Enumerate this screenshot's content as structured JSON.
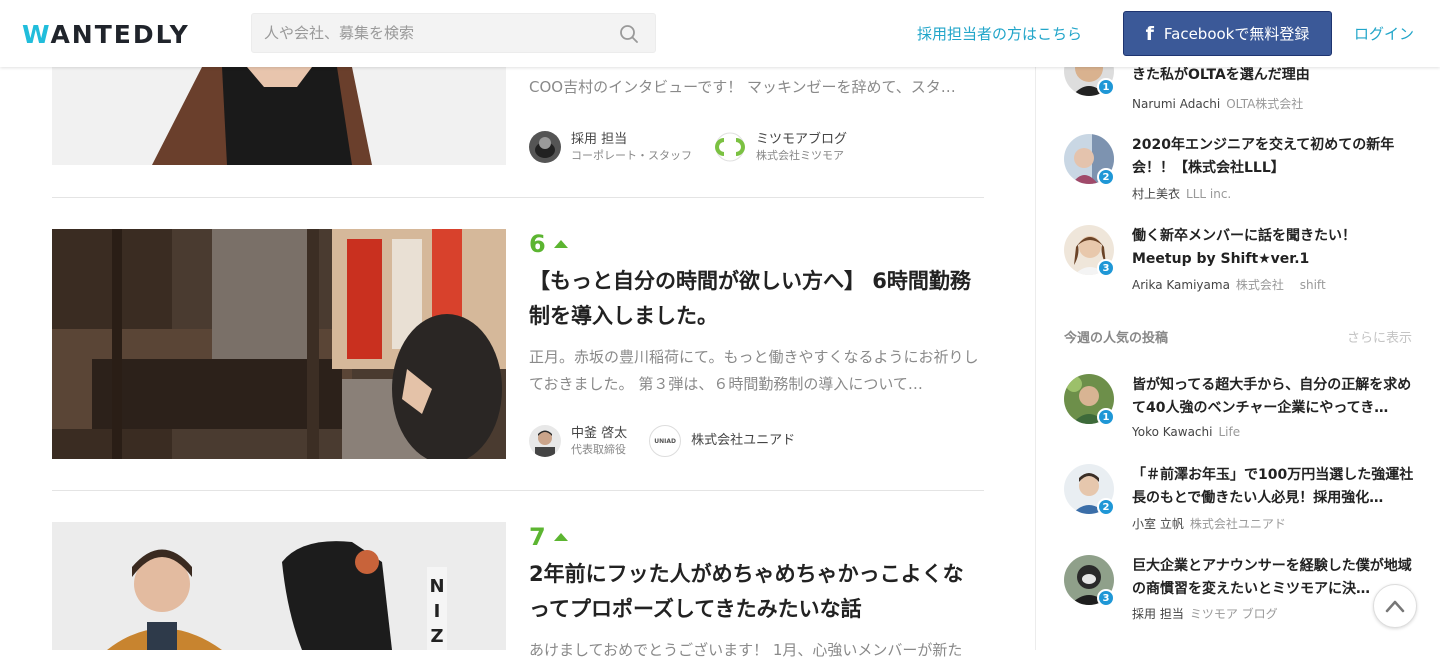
{
  "header": {
    "logo_text": "WANTEDLY",
    "search_placeholder": "人や会社、募集を検索",
    "recruiter_link": "採用担当者の方はこちら",
    "facebook_button": "Facebookで無料登録",
    "login_link": "ログイン"
  },
  "posts": [
    {
      "excerpt": "COO吉村のインタビューです！ マッキンゼーを辞めて、スタ…",
      "author_name": "採用 担当",
      "author_role": "コーポレート・スタッフ",
      "company_name": "ミツモアブログ",
      "company_sub": "株式会社ミツモア"
    },
    {
      "votes": "6",
      "title": "【もっと自分の時間が欲しい方へ】 6時間勤務制を導入しました。",
      "excerpt": "正月。赤坂の豊川稲荷にて。もっと働きやすくなるようにお祈りしておきました。 第３弾は、６時間勤務制の導入について…",
      "author_name": "中釜 啓太",
      "author_role": "代表取締役",
      "company_name": "株式会社ユニアド",
      "company_logo_text": "UNIAD"
    },
    {
      "votes": "7",
      "title": "2年前にフッた人がめちゃめちゃかっこよくなってプロポーズしてきたみたいな話",
      "excerpt": "あけましておめでとうございます！ 1月、心強いメンバーが新た"
    }
  ],
  "sidebar": {
    "top_items": [
      {
        "title": "きた私がOLTAを選んだ理由",
        "author": "Narumi Adachi",
        "company": "OLTA株式会社",
        "rank": "1"
      },
      {
        "title": "2020年エンジニアを交えて初めての新年会！！【株式会社LLL】",
        "author": "村上美衣",
        "company": "LLL inc.",
        "rank": "2"
      },
      {
        "title": "働く新卒メンバーに話を聞きたい！Meetup by Shift★ver.1",
        "author": "Arika Kamiyama",
        "company": "株式会社　 shift",
        "rank": "3"
      }
    ],
    "weekly_title": "今週の人気の投稿",
    "weekly_more": "さらに表示",
    "weekly_items": [
      {
        "title": "皆が知ってる超大手から、自分の正解を求めて40人強のベンチャー企業にやってき…",
        "author": "Yoko Kawachi",
        "company": "Life",
        "rank": "1"
      },
      {
        "title": "「＃前澤お年玉」で100万円当選した強運社長のもとで働きたい人必見！採用強化…",
        "author": "小室 立帆",
        "company": "株式会社ユニアド",
        "rank": "2"
      },
      {
        "title": "巨大企業とアナウンサーを経験した僕が地域の商慣習を変えたいとミツモアに決…",
        "author": "採用 担当",
        "company": "ミツモア ブログ",
        "rank": "3"
      }
    ]
  },
  "colors": {
    "brand_accent": "#21bddb",
    "link": "#21a5c9",
    "facebook": "#3b5998",
    "vote_green": "#5cb531",
    "rank_badge": "#1f97d6"
  },
  "icons": {
    "search": "search-icon",
    "facebook": "facebook-icon",
    "vote": "upvote-arrow-icon",
    "scroll_top": "chevron-up-icon"
  }
}
